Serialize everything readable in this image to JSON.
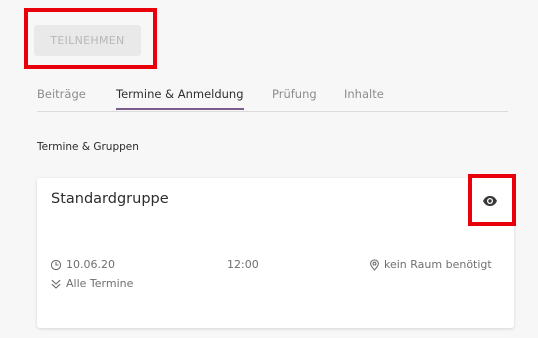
{
  "actions": {
    "join_label": "TEILNEHMEN"
  },
  "tabs": [
    {
      "label": "Beiträge",
      "active": false
    },
    {
      "label": "Termine & Anmeldung",
      "active": true
    },
    {
      "label": "Prüfung",
      "active": false
    },
    {
      "label": "Inhalte",
      "active": false
    }
  ],
  "section": {
    "title": "Termine & Gruppen"
  },
  "group_card": {
    "title": "Standardgruppe",
    "date": "10.06.20",
    "time": "12:00",
    "room": "kein Raum benötigt",
    "all_dates_label": "Alle Termine"
  },
  "icons": {
    "visibility": "eye-icon",
    "date": "clock-icon",
    "room": "location-pin-icon",
    "expand": "double-chevron-down-icon"
  },
  "colors": {
    "highlight": "#e8000b",
    "active_tab_underline": "#7b5c8c"
  }
}
